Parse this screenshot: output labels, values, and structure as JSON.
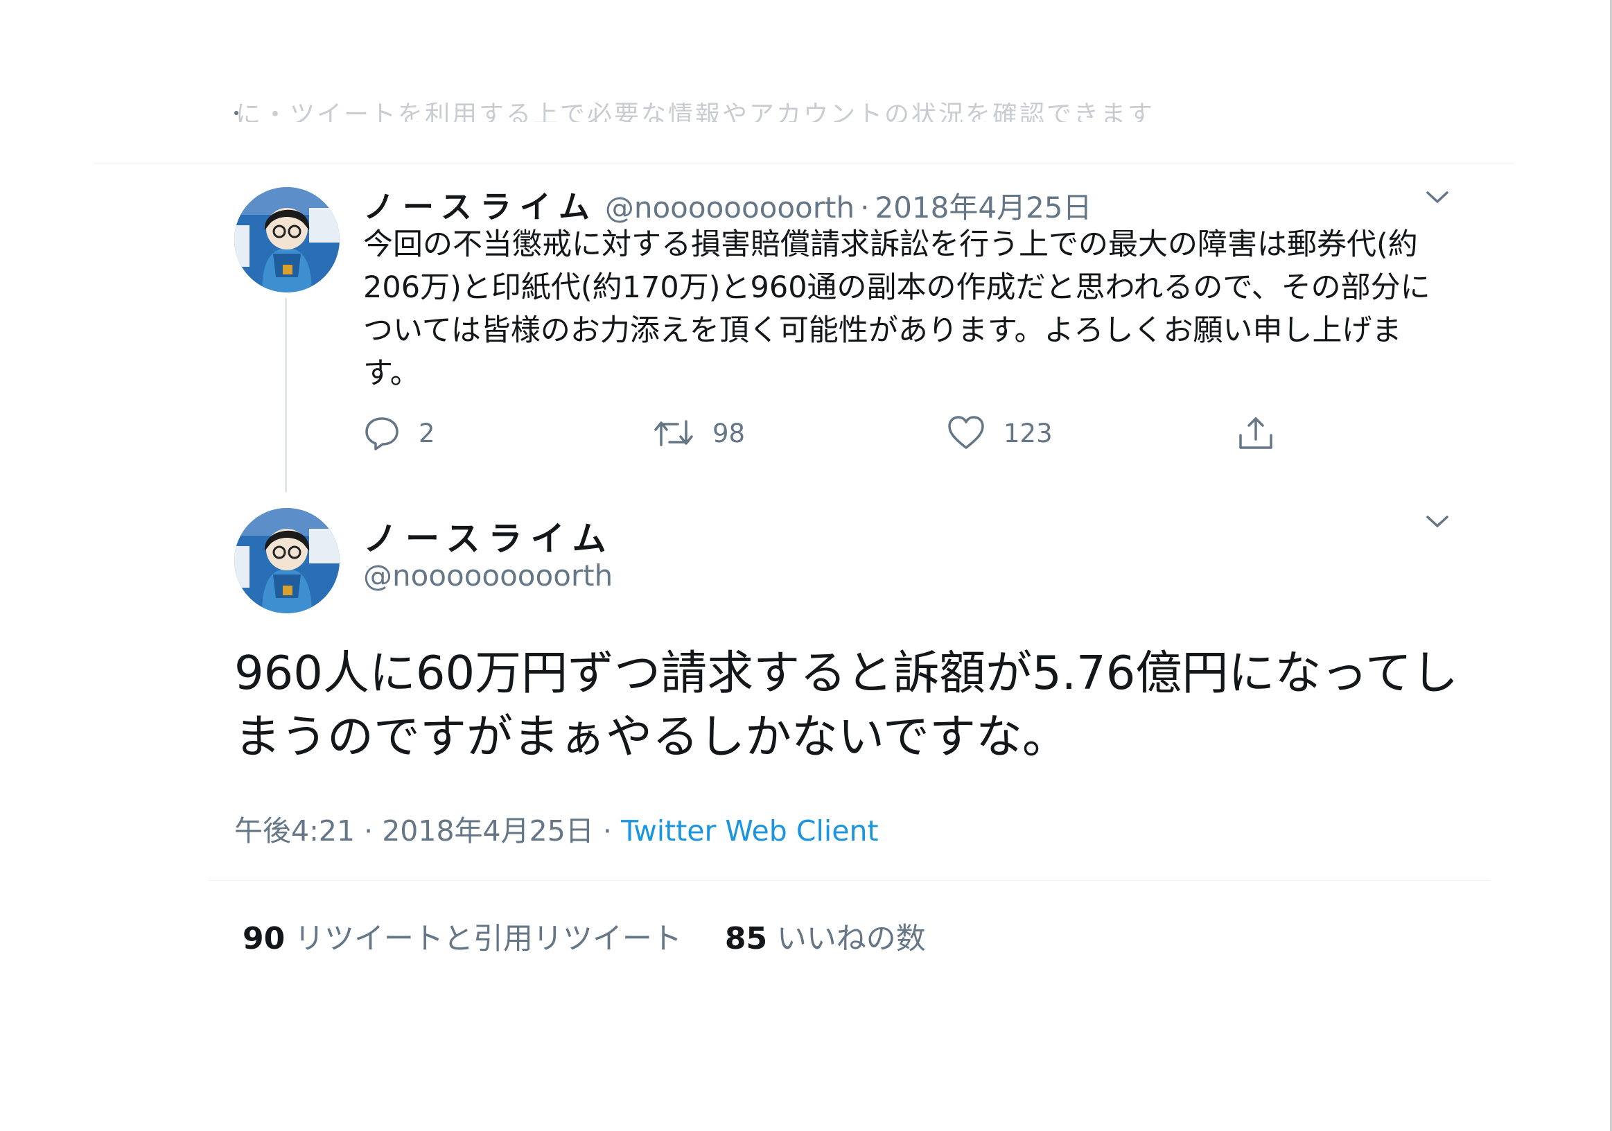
{
  "cut_off_text": "に・ツイートを利用する上で必要な情報やアカウントの状況を確認できます",
  "tweets": [
    {
      "name": "ノースライム",
      "handle": "@nooooooooorth",
      "separator": "·",
      "date": "2018年4月25日",
      "text": "今回の不当懲戒に対する損害賠償請求訴訟を行う上での最大の障害は郵券代(約206万)と印紙代(約170万)と960通の副本の作成だと思われるので、その部分については皆様のお力添えを頂く可能性があります。よろしくお願い申し上げます。",
      "counts": {
        "replies": "2",
        "retweets": "98",
        "likes": "123"
      },
      "icons": [
        "reply-icon",
        "retweet-icon",
        "like-icon",
        "share-icon",
        "chevron-down-icon"
      ]
    },
    {
      "name": "ノースライム",
      "handle": "@nooooooooorth",
      "text": "960人に60万円ずつ請求すると訴額が5.76億円になってしまうのですがまぁやるしかないですな。",
      "time": "午後4:21",
      "separator": "·",
      "date": "2018年4月25日",
      "client": "Twitter Web Client"
    }
  ],
  "stats": {
    "retweet_count": "90",
    "retweet_label": "リツイートと引用リツイート",
    "like_count": "85",
    "like_label": "いいねの数"
  },
  "colors": {
    "text": "#14171a",
    "muted": "#657786",
    "link": "#1b95e0",
    "avatar_bg": "#2a6fb5"
  }
}
